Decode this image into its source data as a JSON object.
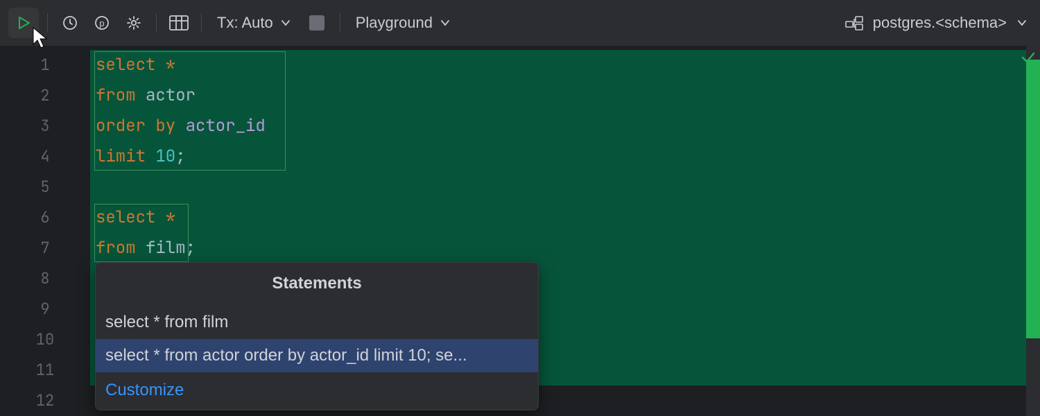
{
  "toolbar": {
    "tx_label": "Tx: Auto",
    "playground_label": "Playground"
  },
  "connection": {
    "label": "postgres.<schema>"
  },
  "editor": {
    "line_numbers": [
      "1",
      "2",
      "3",
      "4",
      "5",
      "6",
      "7",
      "8",
      "9",
      "10",
      "11",
      "12"
    ],
    "lines": {
      "l1_kw": "select",
      "l1_star": " *",
      "l2_kw": "from",
      "l2_id": " actor",
      "l3_kw": "order by",
      "l3_id": " actor_id",
      "l4_kw": "limit",
      "l4_num": " 10",
      "l4_p": ";",
      "l6_kw": "select",
      "l6_star": " *",
      "l7_kw": "from",
      "l7_id": " film",
      "l7_p": ";"
    }
  },
  "popup": {
    "title": "Statements",
    "items": [
      "select * from film",
      "select * from actor order by actor_id limit 10; se..."
    ],
    "customize": "Customize"
  }
}
